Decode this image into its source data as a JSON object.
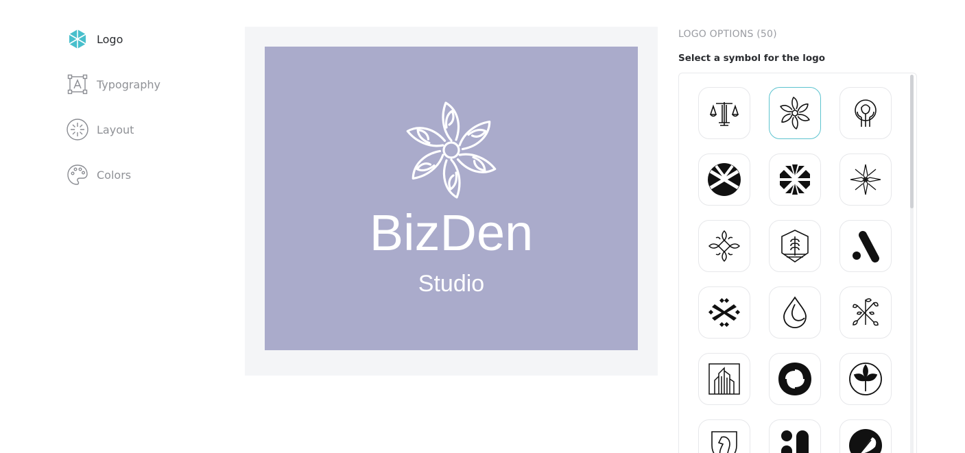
{
  "nav": {
    "items": [
      {
        "label": "Logo",
        "icon": "logo-hexagon-icon",
        "active": true
      },
      {
        "label": "Typography",
        "icon": "typography-icon",
        "active": false
      },
      {
        "label": "Layout",
        "icon": "layout-icon",
        "active": false
      },
      {
        "label": "Colors",
        "icon": "palette-icon",
        "active": false
      }
    ]
  },
  "preview": {
    "brand_name": "BizDen",
    "tagline": "Studio",
    "background_color": "#aaabcb",
    "frame_color": "#f4f5f7",
    "symbol": "flower-swirl-icon"
  },
  "options": {
    "heading": "LOGO OPTIONS (50)",
    "subheading": "Select a symbol for the logo",
    "accent_color": "#5cc3cf",
    "symbols": [
      "scales-of-justice-icon",
      "flower-swirl-icon",
      "rose-in-circle-icon",
      "crossed-circle-icon",
      "geometric-snowflake-icon",
      "outline-star-flower-icon",
      "four-leaf-ornament-icon",
      "wheat-hexagon-icon",
      "abstract-a-icon",
      "dotted-x-icon",
      "water-drop-icon",
      "leafy-branch-icon",
      "building-frame-icon",
      "aperture-swirl-icon",
      "leaf-circle-icon",
      "horse-shield-icon",
      "dot-pillar-icon",
      "feather-circle-icon"
    ]
  }
}
